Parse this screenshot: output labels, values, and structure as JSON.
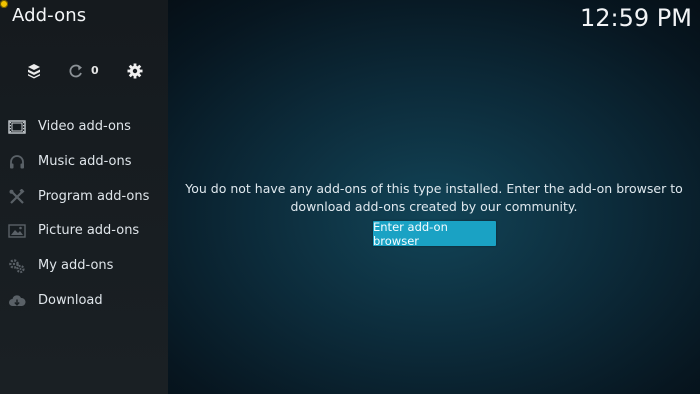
{
  "app": {
    "title": "Add-ons",
    "clock": "12:59 PM"
  },
  "toolbar": {
    "items": [
      {
        "icon": "box-icon"
      },
      {
        "icon": "refresh-icon",
        "count": "0"
      },
      {
        "icon": "gear-icon"
      }
    ]
  },
  "sidebar": {
    "items": [
      {
        "label": "Video add-ons",
        "icon": "film-icon"
      },
      {
        "label": "Music add-ons",
        "icon": "headphones-icon"
      },
      {
        "label": "Program add-ons",
        "icon": "tools-icon"
      },
      {
        "label": "Picture add-ons",
        "icon": "picture-icon"
      },
      {
        "label": "My add-ons",
        "icon": "gears-icon"
      },
      {
        "label": "Download",
        "icon": "cloud-download-icon"
      }
    ]
  },
  "main": {
    "message": "You do not have any add-ons of this type installed. Enter the add-on browser to download add-ons created by our community.",
    "button_label": "Enter add-on browser"
  },
  "colors": {
    "accent": "#1aa2c4",
    "sidebar_bg": "#171c20",
    "background": "#0c2a39"
  }
}
